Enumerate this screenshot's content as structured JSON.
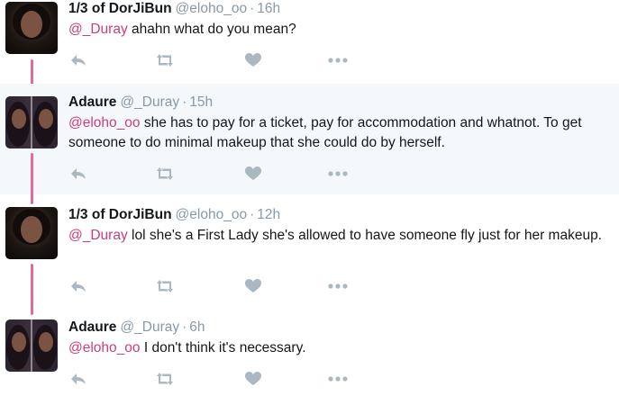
{
  "tweets": [
    {
      "name": "1/3 of DorJiBun",
      "handle": "@eloho_oo",
      "separator": "·",
      "time": "16h",
      "mention": "@_Duray",
      "text": " ahahn what do you mean?"
    },
    {
      "name": "Adaure",
      "handle": "@_Duray",
      "separator": "·",
      "time": "15h",
      "mention": "@eloho_oo",
      "text": " she has to pay for a ticket, pay for accommodation and whatnot. To get someone to do minimal makeup that she could do by herself."
    },
    {
      "name": "1/3 of DorJiBun",
      "handle": "@eloho_oo",
      "separator": "·",
      "time": "12h",
      "mention": "@_Duray",
      "text": " lol she's a First Lady she's allowed to have someone fly just for her makeup."
    },
    {
      "name": "Adaure",
      "handle": "@_Duray",
      "separator": "·",
      "time": "6h",
      "mention": "@eloho_oo",
      "text": " I don't think it's necessary."
    }
  ],
  "icons": {
    "reply": "reply-icon",
    "retweet": "retweet-icon",
    "like": "heart-icon",
    "more": "more-icon"
  },
  "colors": {
    "mention": "#cc3d7d",
    "thread_line": "#e36b9c",
    "icon_gray": "#aab8c2",
    "meta_gray": "#8899a6",
    "alt_background": "#f5f8fa"
  }
}
